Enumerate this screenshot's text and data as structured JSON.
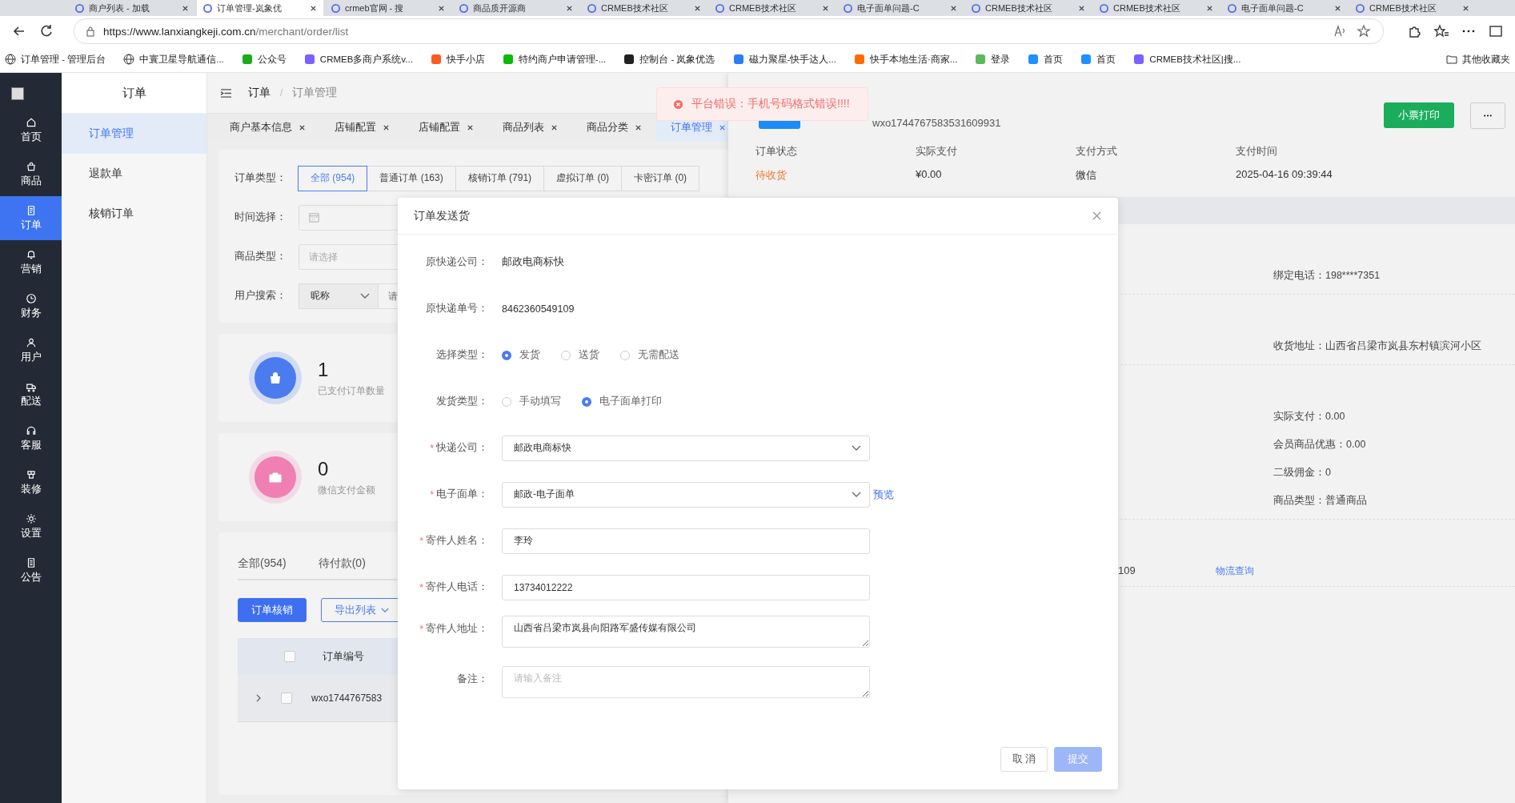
{
  "browser": {
    "tabs": [
      {
        "title": "商户列表 - 加载",
        "selected": false
      },
      {
        "title": "订单管理-岚象优",
        "selected": true
      },
      {
        "title": "crmeb官网 - 搜",
        "selected": false
      },
      {
        "title": "商品质开源商",
        "selected": false
      },
      {
        "title": "CRMEB技术社区",
        "selected": false
      },
      {
        "title": "CRMEB技术社区",
        "selected": false
      },
      {
        "title": "电子面单问题-C",
        "selected": false
      },
      {
        "title": "CRMEB技术社区",
        "selected": false
      },
      {
        "title": "CRMEB技术社区",
        "selected": false
      },
      {
        "title": "电子面单问题-C",
        "selected": false
      },
      {
        "title": "CRMEB技术社区",
        "selected": false
      }
    ],
    "url_host": "https://www.lanxiangkeji.com.cn",
    "url_path": "/merchant/order/list",
    "bookmarks": [
      "订单管理 - 管理后台",
      "中寰卫星导航通信...",
      "公众号",
      "CRMEB多商户系统v...",
      "快手小店",
      "特约商户申请管理-...",
      "控制台 - 岚象优选",
      "磁力聚星-快手达人...",
      "快手本地生活·商家...",
      "登录",
      "首页",
      "首页",
      "CRMEB技术社区|搜..."
    ],
    "other_bookmarks": "其他收藏夹"
  },
  "nav": {
    "items": [
      {
        "label": "首页",
        "selected": false
      },
      {
        "label": "商品",
        "selected": false
      },
      {
        "label": "订单",
        "selected": true
      },
      {
        "label": "营销",
        "selected": false
      },
      {
        "label": "财务",
        "selected": false
      },
      {
        "label": "用户",
        "selected": false
      },
      {
        "label": "配送",
        "selected": false
      },
      {
        "label": "客服",
        "selected": false
      },
      {
        "label": "装修",
        "selected": false
      },
      {
        "label": "设置",
        "selected": false
      },
      {
        "label": "公告",
        "selected": false
      }
    ]
  },
  "subnav": {
    "title": "订单",
    "items": [
      {
        "label": "订单管理",
        "selected": true
      },
      {
        "label": "退款单",
        "selected": false
      },
      {
        "label": "核销订单",
        "selected": false
      }
    ]
  },
  "breadcrumb": [
    "订单",
    "订单管理"
  ],
  "breadcrumb_separator": "/",
  "page_tabs": [
    {
      "label": "商户基本信息",
      "selected": false
    },
    {
      "label": "店铺配置",
      "selected": false
    },
    {
      "label": "店铺配置",
      "selected": false
    },
    {
      "label": "商品列表",
      "selected": false
    },
    {
      "label": "商品分类",
      "selected": false
    },
    {
      "label": "订单管理",
      "selected": true
    }
  ],
  "filters": {
    "order_type": {
      "label": "订单类型：",
      "options": [
        {
          "label": "全部 (954)",
          "selected": true
        },
        {
          "label": "普通订单 (163)",
          "selected": false
        },
        {
          "label": "核销订单 (791)",
          "selected": false
        },
        {
          "label": "虚拟订单 (0)",
          "selected": false
        },
        {
          "label": "卡密订单 (0)",
          "selected": false
        }
      ]
    },
    "time": {
      "label": "时间选择："
    },
    "product_type": {
      "label": "商品类型：",
      "placeholder": "请选择"
    },
    "user_search": {
      "label": "用户搜索：",
      "select": "昵称",
      "placeholder": "请"
    }
  },
  "stats": [
    {
      "value": "1",
      "label": "已支付订单数量",
      "color": "#4a7cf0"
    },
    {
      "value": "0",
      "label": "微信支付金额",
      "color": "#f07fb4"
    }
  ],
  "list": {
    "tabs": [
      "全部(954)",
      "待付款(0)"
    ],
    "buttons": [
      {
        "label": "订单核销",
        "kind": "primary"
      },
      {
        "label": "导出列表",
        "kind": "outline"
      }
    ],
    "columns": [
      "订单编号"
    ],
    "header_checked": false,
    "rows": [
      {
        "order_no": "wxo1744767583",
        "checked": false
      }
    ]
  },
  "drawer": {
    "order_no": "wxo1744767583531609931",
    "print_button": "小票打印",
    "summary": [
      {
        "label": "订单状态",
        "value": "待收货",
        "highlight": true
      },
      {
        "label": "实际支付",
        "value": "¥0.00",
        "highlight": false
      },
      {
        "label": "支付方式",
        "value": "微信",
        "highlight": false
      },
      {
        "label": "支付时间",
        "value": "2025-04-16 09:39:44",
        "highlight": false
      }
    ],
    "sections": [
      {
        "rows": [
          {
            "label": "绑定电话：",
            "value": "198****7351"
          }
        ]
      },
      {
        "rows": [
          {
            "label": "收货地址：",
            "value": "山西省吕梁市岚县东村镇滨河小区"
          }
        ]
      },
      {
        "rows": [
          {
            "label": "实际支付：",
            "value": "0.00"
          },
          {
            "label": "会员商品优惠：",
            "value": "0.00"
          },
          {
            "label": "二级佣金：",
            "value": "0"
          },
          {
            "label": "商品类型：",
            "value": "普通商品"
          }
        ]
      }
    ],
    "tracking": {
      "number_tail": "109",
      "link": "物流查询"
    }
  },
  "toast": {
    "message": "平台错误：手机号码格式错误!!!!"
  },
  "modal": {
    "title": "订单发送货",
    "required_mark": "*",
    "fields": [
      {
        "kind": "text",
        "label": "原快递公司：",
        "value": "邮政电商标快",
        "required": false
      },
      {
        "kind": "text",
        "label": "原快递单号：",
        "value": "8462360549109",
        "required": false
      },
      {
        "kind": "radio",
        "label": "选择类型：",
        "required": false,
        "options": [
          {
            "label": "发货",
            "selected": true
          },
          {
            "label": "送货",
            "selected": false
          },
          {
            "label": "无需配送",
            "selected": false
          }
        ]
      },
      {
        "kind": "radio",
        "label": "发货类型：",
        "required": false,
        "options": [
          {
            "label": "手动填写",
            "selected": false
          },
          {
            "label": "电子面单打印",
            "selected": true
          }
        ]
      },
      {
        "kind": "select",
        "label": "快递公司：",
        "value": "邮政电商标快",
        "required": true
      },
      {
        "kind": "select",
        "label": "电子面单：",
        "value": "邮政-电子面单",
        "required": true,
        "link": "预览"
      },
      {
        "kind": "input",
        "label": "寄件人姓名：",
        "value": "李玲",
        "required": true
      },
      {
        "kind": "input",
        "label": "寄件人电话：",
        "value": "13734012222",
        "required": true
      },
      {
        "kind": "textarea",
        "label": "寄件人地址：",
        "value": "山西省吕梁市岚县向阳路军盛传媒有限公司",
        "required": true
      },
      {
        "kind": "textarea",
        "label": "备注：",
        "placeholder": "请输入备注",
        "required": false
      }
    ],
    "buttons": [
      {
        "label": "取 消",
        "kind": "cancel"
      },
      {
        "label": "提交",
        "kind": "submit"
      }
    ]
  }
}
